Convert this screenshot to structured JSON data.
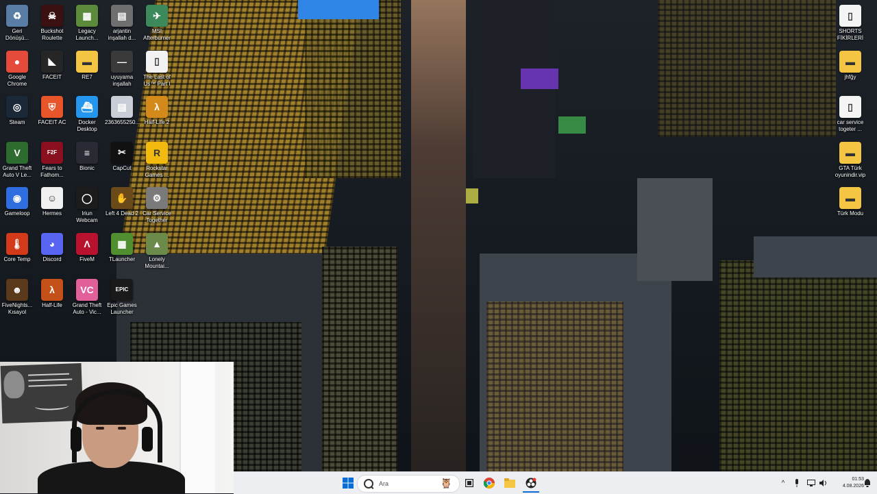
{
  "desktop": {
    "icons_left": [
      {
        "label": "Geri\nDönüşü...",
        "glyph": "♻",
        "color": "#5a7da6"
      },
      {
        "label": "Buckshot\nRoulette",
        "glyph": "☠",
        "color": "#3a1010"
      },
      {
        "label": "Legacy\nLaunch...",
        "glyph": "▦",
        "color": "#5a8a3a"
      },
      {
        "label": "arjantin\ninşallah d...",
        "glyph": "▤",
        "color": "#6f6f6f"
      },
      {
        "label": "MSI\nAfterburner",
        "glyph": "✈",
        "color": "#3c8a5c"
      },
      {
        "label": "Google\nChrome",
        "glyph": "●",
        "color": "#e44b3a"
      },
      {
        "label": "FACEIT",
        "glyph": "◣",
        "color": "#262626"
      },
      {
        "label": "RE7",
        "glyph": "▬",
        "color": "#f4c542"
      },
      {
        "label": "uyuyama\ninşallah",
        "glyph": "—",
        "color": "#3a3a3a"
      },
      {
        "label": "The Last of\nUs™ Part I",
        "glyph": "▯",
        "color": "#f2f2f2"
      },
      {
        "label": "Steam",
        "glyph": "◎",
        "color": "#1b2838"
      },
      {
        "label": "FACEIT AC",
        "glyph": "⛨",
        "color": "#e8552a"
      },
      {
        "label": "Docker\nDesktop",
        "glyph": "⛴",
        "color": "#2496ed"
      },
      {
        "label": "2363655250...",
        "glyph": "▤",
        "color": "#c9ced6"
      },
      {
        "label": "Half-Life 2",
        "glyph": "λ",
        "color": "#d48a1a"
      },
      {
        "label": "Grand Theft\nAuto V Le...",
        "glyph": "V",
        "color": "#2e6b2e"
      },
      {
        "label": "Fears to\nFathom...",
        "glyph": "F2F",
        "color": "#8a1020"
      },
      {
        "label": "Bionic",
        "glyph": "≡",
        "color": "#2a2a35"
      },
      {
        "label": "CapCut",
        "glyph": "✂",
        "color": "#111111"
      },
      {
        "label": "Rockstar\nGames ...",
        "glyph": "R",
        "color": "#f2b90f"
      },
      {
        "label": "Gameloop",
        "glyph": "◉",
        "color": "#2f6ee0"
      },
      {
        "label": "Hermes",
        "glyph": "☺",
        "color": "#f0f0f0"
      },
      {
        "label": "Iriun\nWebcam",
        "glyph": "◯",
        "color": "#1c1c1c"
      },
      {
        "label": "Left 4 Dead 2",
        "glyph": "✋",
        "color": "#6b4a1a"
      },
      {
        "label": "Car Service\nTogether",
        "glyph": "⚙",
        "color": "#7a7a7a"
      },
      {
        "label": "Core Temp",
        "glyph": "🌡",
        "color": "#d23a1a"
      },
      {
        "label": "Discord",
        "glyph": "◕",
        "color": "#5865f2"
      },
      {
        "label": "FiveM",
        "glyph": "Λ",
        "color": "#b8122e"
      },
      {
        "label": "TLauncher",
        "glyph": "▦",
        "color": "#4f8f2f"
      },
      {
        "label": "Lonely\nMountai...",
        "glyph": "▲",
        "color": "#6c8a4a"
      },
      {
        "label": "FiveNights...\nKısayol",
        "glyph": "☻",
        "color": "#5a3a1a"
      },
      {
        "label": "Half-Life",
        "glyph": "λ",
        "color": "#c4501a"
      },
      {
        "label": "Grand Theft\nAuto - Vic...",
        "glyph": "VC",
        "color": "#e2609a"
      },
      {
        "label": "Epic Games\nLauncher",
        "glyph": "EPIC",
        "color": "#1a1a1a"
      }
    ],
    "icons_right": [
      {
        "label": "SHORTS\nFİKİRLERİ",
        "glyph": "▯",
        "color": "#f4f4f4"
      },
      {
        "label": "jhfğy",
        "glyph": "▬",
        "color": "#f4c542"
      },
      {
        "label": "car service\ntogeter ...",
        "glyph": "▯",
        "color": "#f4f4f4"
      },
      {
        "label": "GTA Türk\noyunindir.vip",
        "glyph": "▬",
        "color": "#f4c542"
      },
      {
        "label": "Türk Modu",
        "glyph": "▬",
        "color": "#f4c542"
      }
    ]
  },
  "taskbar": {
    "search_placeholder": "Ara",
    "time": "01:53",
    "date": "4.08.2026"
  }
}
